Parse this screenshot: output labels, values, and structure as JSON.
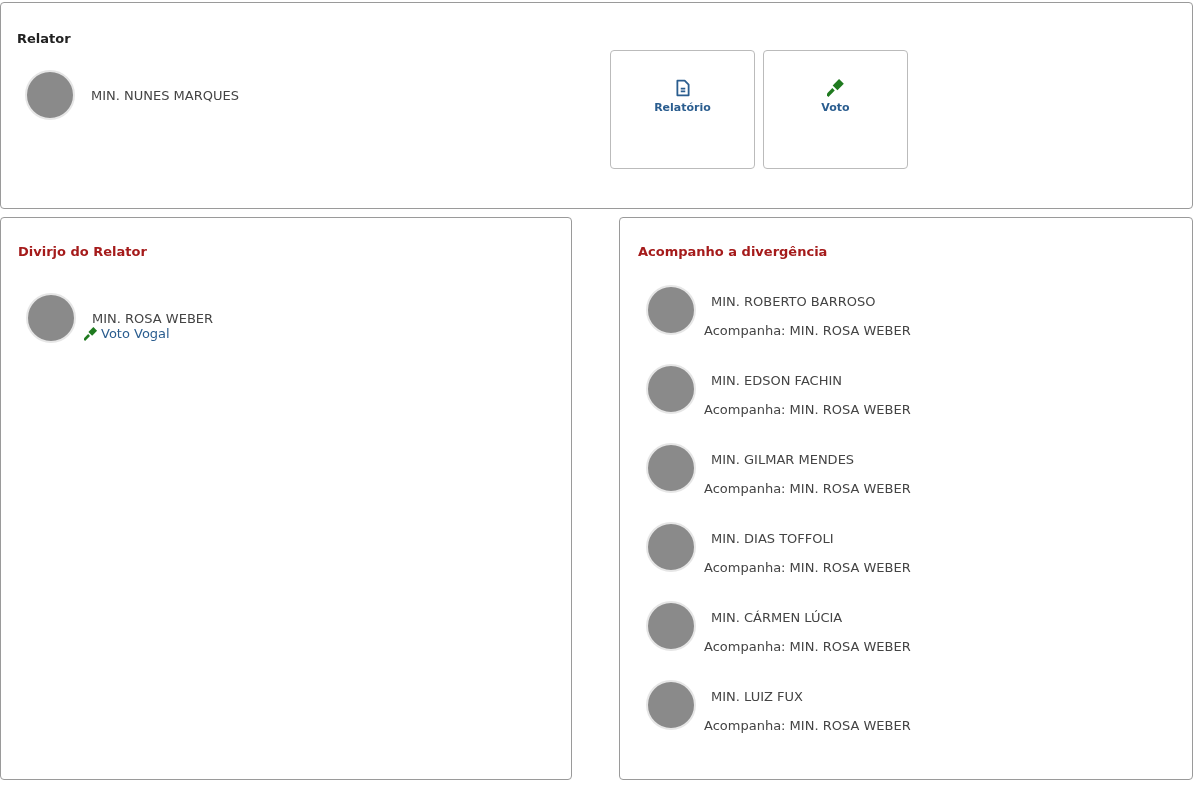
{
  "relator": {
    "title": "Relator",
    "minister": "MIN. NUNES MARQUES",
    "actions": [
      {
        "label": "Relatório",
        "kind": "document"
      },
      {
        "label": "Voto",
        "kind": "gavel"
      }
    ]
  },
  "divergence": {
    "title": "Divirjo do Relator",
    "minister": "MIN. ROSA WEBER",
    "link": "Voto Vogal"
  },
  "following": {
    "title": "Acompanho a divergência",
    "items": [
      {
        "minister": "MIN. ROBERTO BARROSO",
        "note": "Acompanha: MIN. ROSA WEBER"
      },
      {
        "minister": "MIN. EDSON FACHIN",
        "note": "Acompanha: MIN. ROSA WEBER"
      },
      {
        "minister": "MIN. GILMAR MENDES",
        "note": "Acompanha: MIN. ROSA WEBER"
      },
      {
        "minister": "MIN. DIAS TOFFOLI",
        "note": "Acompanha: MIN. ROSA WEBER"
      },
      {
        "minister": "MIN. CÁRMEN LÚCIA",
        "note": "Acompanha: MIN. ROSA WEBER"
      },
      {
        "minister": "MIN. LUIZ FUX",
        "note": "Acompanha: MIN. ROSA WEBER"
      }
    ]
  }
}
